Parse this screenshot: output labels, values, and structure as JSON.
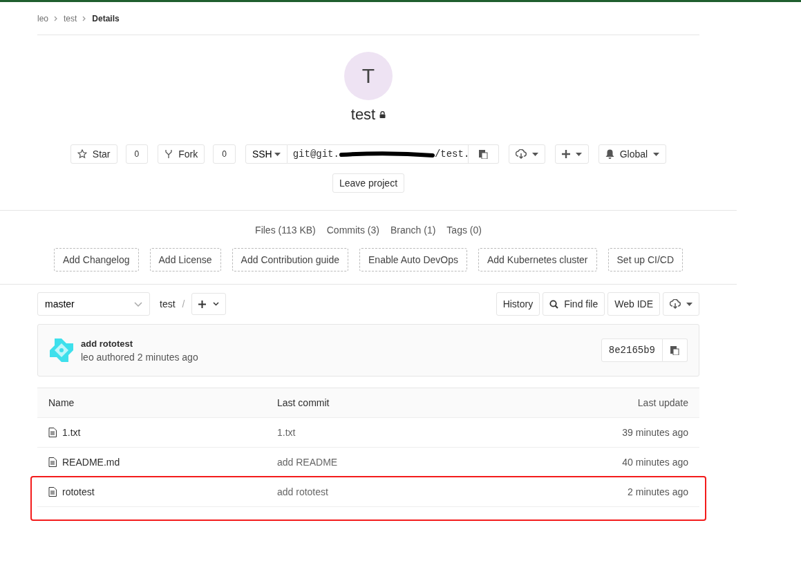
{
  "breadcrumbs": [
    {
      "label": "leo",
      "current": false
    },
    {
      "label": "test",
      "current": false
    },
    {
      "label": "Details",
      "current": true
    }
  ],
  "project": {
    "avatar_letter": "T",
    "name": "test",
    "private": true
  },
  "actions": {
    "star": {
      "label": "Star",
      "count": "0"
    },
    "fork": {
      "label": "Fork",
      "count": "0"
    },
    "protocol": "SSH",
    "url_start": "git@git.",
    "url_end": "/test.",
    "notifications": "Global",
    "leave": "Leave project"
  },
  "stats": [
    "Files (113 KB)",
    "Commits (3)",
    "Branch (1)",
    "Tags (0)"
  ],
  "suggestions": [
    "Add Changelog",
    "Add License",
    "Add Contribution guide",
    "Enable Auto DevOps",
    "Add Kubernetes cluster",
    "Set up CI/CD"
  ],
  "tree_bar": {
    "branch": "master",
    "path": "test",
    "separator": "/",
    "buttons": [
      "History",
      "Find file",
      "Web IDE"
    ]
  },
  "last_commit": {
    "title": "add rototest",
    "meta": "leo authored 2 minutes ago",
    "sha": "8e2165b9"
  },
  "table": {
    "columns": [
      "Name",
      "Last commit",
      "Last update"
    ],
    "rows": [
      {
        "name": "1.txt",
        "commit": "1.txt",
        "updated": "39 minutes ago",
        "highlighted": false
      },
      {
        "name": "README.md",
        "commit": "add README",
        "updated": "40 minutes ago",
        "highlighted": false
      },
      {
        "name": "rototest",
        "commit": "add rototest",
        "updated": "2 minutes ago",
        "highlighted": true
      }
    ]
  }
}
